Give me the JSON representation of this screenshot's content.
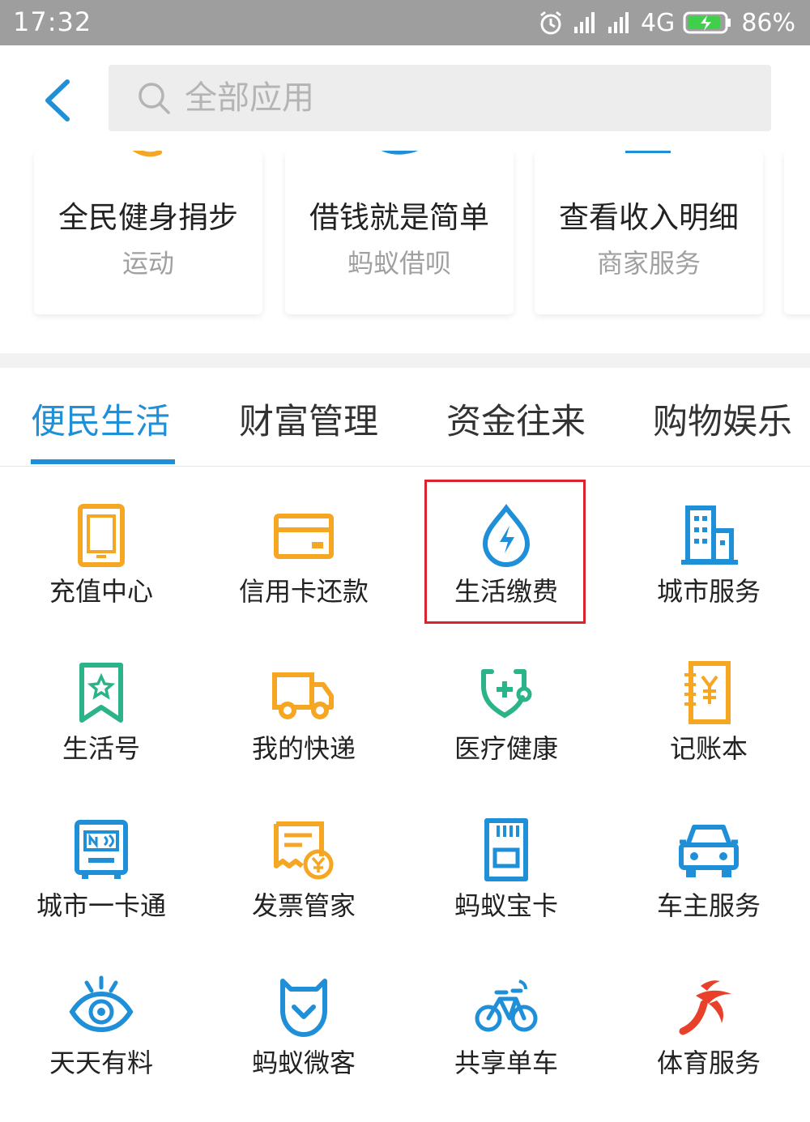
{
  "status_bar": {
    "time": "17:32",
    "network": "4G",
    "battery": "86%"
  },
  "header": {
    "search_placeholder": "全部应用"
  },
  "cards": [
    {
      "title": "全民健身捐步",
      "subtitle": "运动",
      "icon": "running-icon",
      "color": "#f5a623"
    },
    {
      "title": "借钱就是简单",
      "subtitle": "蚂蚁借呗",
      "icon": "money-hand-icon",
      "color": "#1f8fd8"
    },
    {
      "title": "查看收入明细",
      "subtitle": "商家服务",
      "icon": "receipt-icon",
      "color": "#1f8fd8"
    },
    {
      "title": "",
      "subtitle": "",
      "icon": "",
      "color": "#1f8fd8"
    }
  ],
  "tabs": [
    {
      "label": "便民生活",
      "active": true
    },
    {
      "label": "财富管理",
      "active": false
    },
    {
      "label": "资金往来",
      "active": false
    },
    {
      "label": "购物娱乐",
      "active": false
    }
  ],
  "grid": [
    {
      "label": "充值中心",
      "icon": "phone-icon",
      "color": "#f5a623"
    },
    {
      "label": "信用卡还款",
      "icon": "credit-card-icon",
      "color": "#f5a623"
    },
    {
      "label": "生活缴费",
      "icon": "water-bolt-icon",
      "color": "#1f8fd8",
      "highlighted": true
    },
    {
      "label": "城市服务",
      "icon": "building-icon",
      "color": "#1f8fd8"
    },
    {
      "label": "生活号",
      "icon": "bookmark-star-icon",
      "color": "#2bb38a"
    },
    {
      "label": "我的快递",
      "icon": "truck-icon",
      "color": "#f5a623"
    },
    {
      "label": "医疗健康",
      "icon": "stethoscope-icon",
      "color": "#2bb38a"
    },
    {
      "label": "记账本",
      "icon": "ledger-yen-icon",
      "color": "#f5a623"
    },
    {
      "label": "城市一卡通",
      "icon": "nfc-card-icon",
      "color": "#1f8fd8"
    },
    {
      "label": "发票管家",
      "icon": "invoice-icon",
      "color": "#f5a623"
    },
    {
      "label": "蚂蚁宝卡",
      "icon": "sim-card-icon",
      "color": "#1f8fd8"
    },
    {
      "label": "车主服务",
      "icon": "car-icon",
      "color": "#1f8fd8"
    },
    {
      "label": "天天有料",
      "icon": "eye-icon",
      "color": "#1f8fd8"
    },
    {
      "label": "蚂蚁微客",
      "icon": "shield-check-icon",
      "color": "#1f8fd8"
    },
    {
      "label": "共享单车",
      "icon": "bicycle-icon",
      "color": "#1f8fd8"
    },
    {
      "label": "体育服务",
      "icon": "sport-logo-icon",
      "color": "#e8402a"
    }
  ]
}
